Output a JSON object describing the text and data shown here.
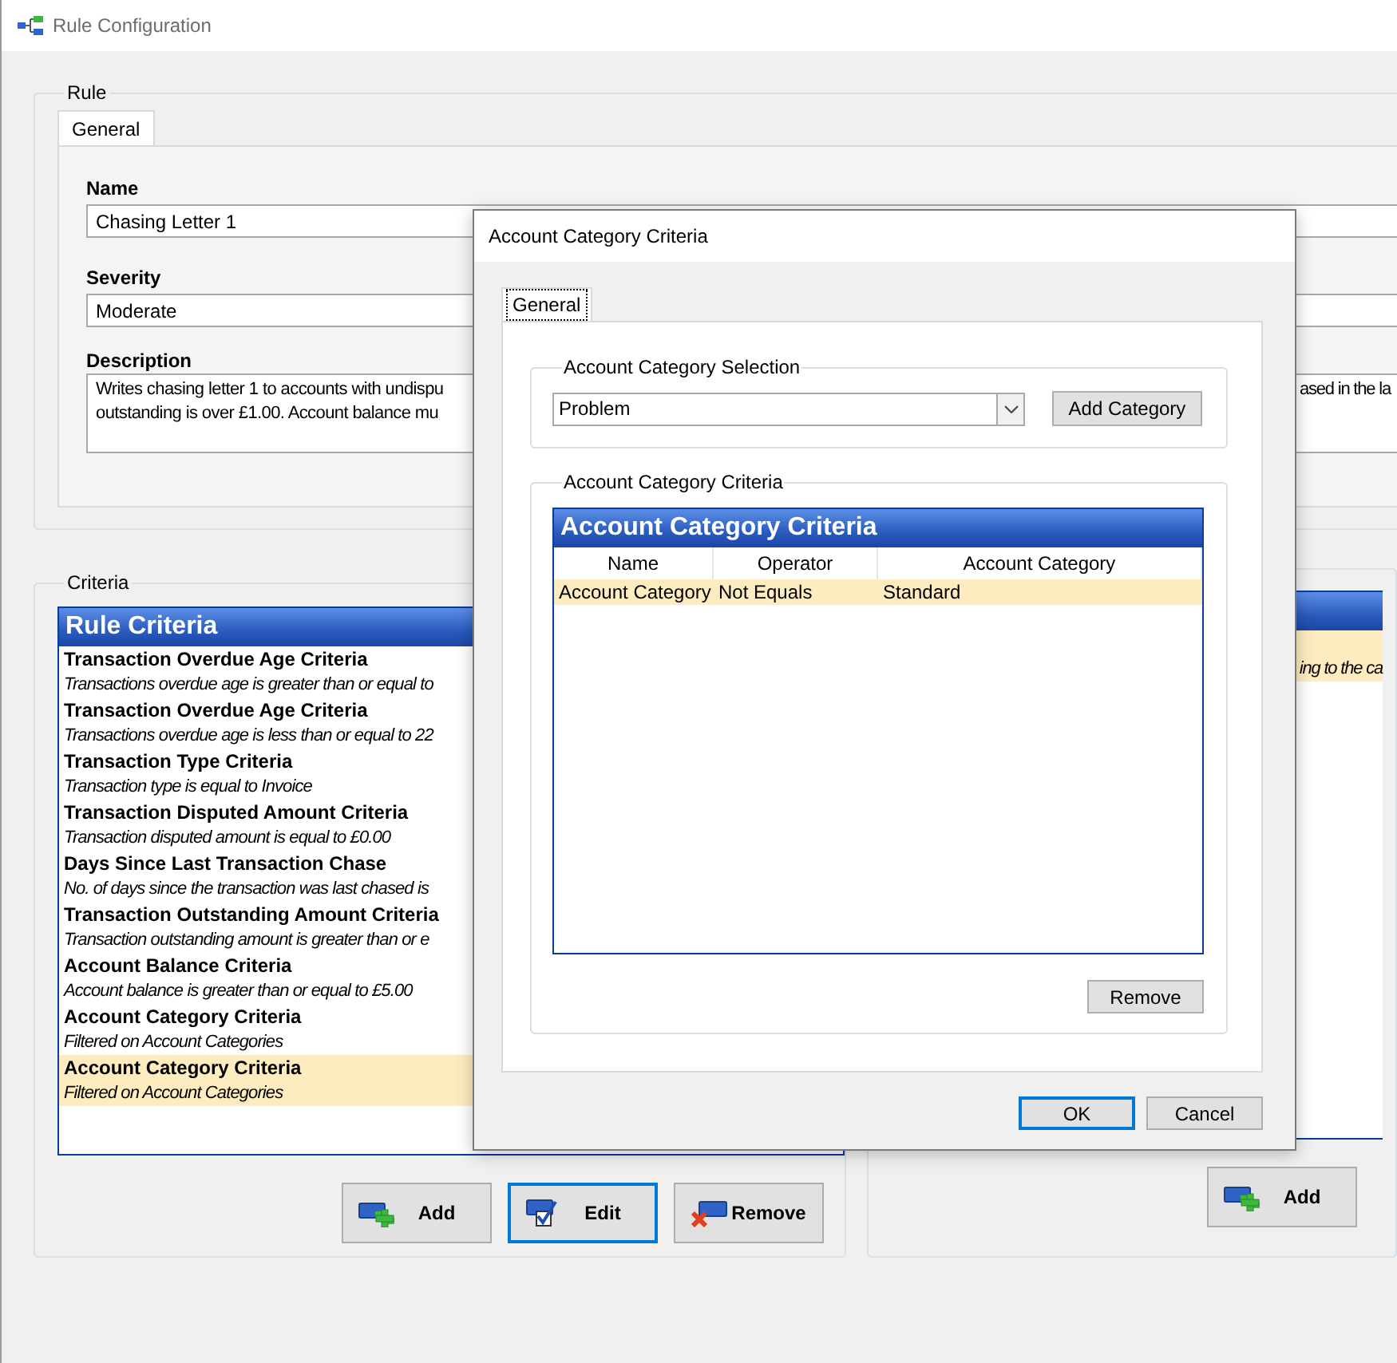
{
  "window": {
    "title": "Rule Configuration"
  },
  "rule": {
    "legend": "Rule",
    "tabs": [
      {
        "label": "General",
        "selected": true
      }
    ],
    "fields": [
      {
        "label": "Name",
        "value": "Chasing Letter 1"
      },
      {
        "label": "Severity",
        "value": "Moderate"
      }
    ],
    "description": {
      "label": "Description",
      "lines": [
        {
          "left": "Writes chasing letter 1 to accounts with undispu",
          "right": "ased in the la"
        },
        {
          "left": "outstanding is over £1.00. Account balance mu"
        }
      ]
    }
  },
  "criteria": {
    "legend": "Criteria",
    "list": {
      "title": "Rule Criteria",
      "items": [
        {
          "name": "Transaction Overdue Age Criteria",
          "detail": "Transactions overdue age is greater than or equal to",
          "selected": false
        },
        {
          "name": "Transaction Overdue Age Criteria",
          "detail": "Transactions overdue age is less than or equal to 22",
          "selected": false
        },
        {
          "name": "Transaction Type Criteria",
          "detail": "Transaction type is equal to Invoice",
          "selected": false
        },
        {
          "name": "Transaction Disputed Amount Criteria",
          "detail": "Transaction disputed amount is equal to £0.00",
          "selected": false
        },
        {
          "name": "Days Since Last Transaction Chase",
          "detail": "No. of days since the transaction was last chased is",
          "selected": false
        },
        {
          "name": "Transaction Outstanding Amount Criteria",
          "detail": "Transaction outstanding amount is greater than or e",
          "selected": false
        },
        {
          "name": "Account Balance Criteria",
          "detail": "Account balance is greater than or equal to £5.00",
          "selected": false
        },
        {
          "name": "Account Category Criteria",
          "detail": "Filtered on Account Categories",
          "selected": false
        },
        {
          "name": "Account Category Criteria",
          "detail": "Filtered on Account Categories",
          "selected": true
        }
      ]
    },
    "buttons": [
      {
        "label": "Add",
        "kind": "add",
        "focused": false
      },
      {
        "label": "Edit",
        "kind": "edit",
        "focused": true
      },
      {
        "label": "Remove",
        "kind": "remove",
        "focused": false
      }
    ]
  },
  "right_panel": {
    "items": [
      {
        "detail": "ing to the ca",
        "selected": true
      }
    ],
    "buttons": [
      {
        "label": "Add",
        "kind": "add",
        "focused": false
      }
    ]
  },
  "dialog": {
    "title": "Account Category Criteria",
    "tabs": [
      {
        "label": "General",
        "selected": true
      }
    ],
    "selection": {
      "legend": "Account Category Selection",
      "value": "Problem",
      "button": "Add Category"
    },
    "criteria": {
      "legend": "Account Category Criteria",
      "grid_title": "Account Category Criteria",
      "columns": [
        "Name",
        "Operator",
        "Account Category"
      ],
      "rows": [
        {
          "cells": [
            "Account Category",
            "Not Equals",
            "Standard"
          ],
          "selected": true
        }
      ],
      "button": "Remove"
    },
    "buttons": [
      {
        "label": "OK",
        "focused": true
      },
      {
        "label": "Cancel",
        "focused": false
      }
    ]
  }
}
